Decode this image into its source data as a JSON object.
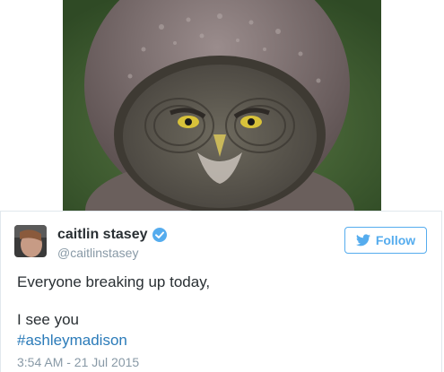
{
  "media": {
    "icon": "owl-photo",
    "colors": {
      "background": "#4a6a3a",
      "plumage": "#8a7e7e",
      "eyes": "#d8c23a"
    }
  },
  "tweet": {
    "author_name": "caitlin stasey",
    "author_handle": "@caitlinstasey",
    "verified_icon": "verified-badge-icon",
    "follow_label": "Follow",
    "follow_icon": "twitter-bird-icon",
    "lines": [
      "Everyone breaking up today,",
      "I see you"
    ],
    "hashtag": "#ashleymadison",
    "timestamp": "3:54 AM - 21 Jul 2015",
    "colors": {
      "accent": "#55acee",
      "link": "#2b7bb9",
      "muted": "#8899a6",
      "text": "#292f33"
    }
  }
}
